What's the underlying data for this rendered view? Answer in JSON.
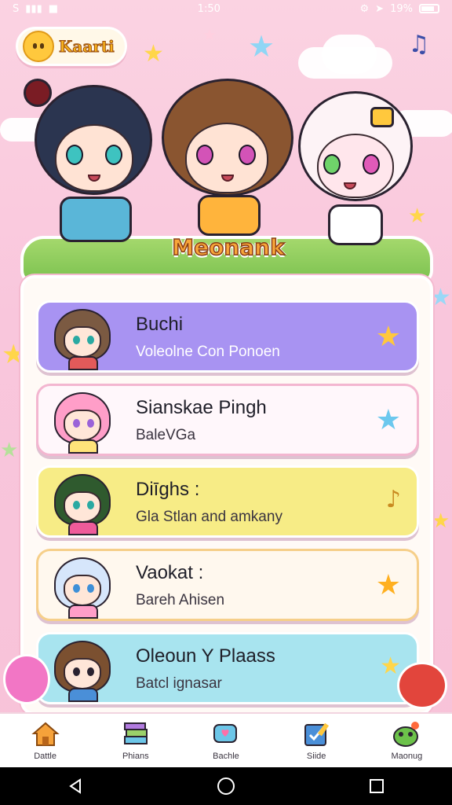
{
  "status_bar": {
    "left_icons": [
      "sim-icon",
      "signal-icon",
      "notification-icon"
    ],
    "time": "1:50",
    "battery": "19%"
  },
  "header": {
    "app_name": "Kaarti",
    "music_icon": "music-note-icon"
  },
  "hero": {
    "title": "Meonank"
  },
  "list": [
    {
      "name": "Buchi",
      "subtitle": "Voleolne Con Ponoen",
      "bg": "#a893f2",
      "deco": "star-icon"
    },
    {
      "name": "Sianskae Pingh",
      "subtitle": "BaleVGa",
      "bg": "#fff7fb",
      "deco": "blue-star-icon"
    },
    {
      "name": "Diīghs :",
      "subtitle": "Gla Stlan and amkany",
      "bg": "#f7ec86",
      "deco": "music-note-icon"
    },
    {
      "name": "Vaokat :",
      "subtitle": "Bareh Ahisen",
      "bg": "#fff8ee",
      "deco": "smiley-star-icon"
    },
    {
      "name": "Oleoun Y Plaass",
      "subtitle": "Batcl ignasar",
      "bg": "#a8e4ef",
      "deco": "star-icon"
    }
  ],
  "bottom_nav": [
    {
      "label": "Dattle",
      "icon": "house-icon"
    },
    {
      "label": "Phians",
      "icon": "books-icon"
    },
    {
      "label": "Bachle",
      "icon": "chat-heart-icon"
    },
    {
      "label": "Siide",
      "icon": "checkbox-pencil-icon"
    },
    {
      "label": "Maonug",
      "icon": "frog-face-icon"
    }
  ],
  "colors": {
    "background": "#f9c6dc",
    "accent_purple": "#a893f2",
    "accent_yellow": "#f7ec86",
    "accent_blue": "#a8e4ef"
  }
}
